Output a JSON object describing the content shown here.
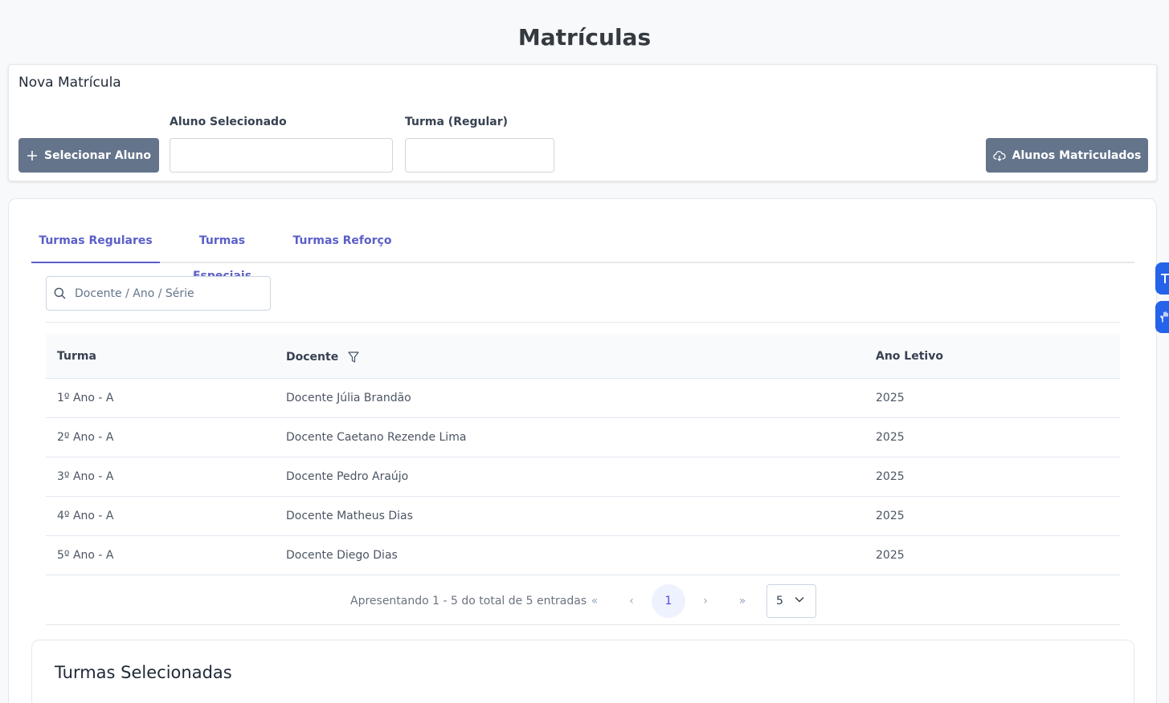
{
  "page": {
    "title": "Matrículas"
  },
  "new_enrollment": {
    "title": "Nova Matrícula",
    "select_student_button": "Selecionar Aluno",
    "student_label": "Aluno Selecionado",
    "student_value": "",
    "class_label": "Turma (Regular)",
    "class_value": "",
    "enrolled_button": "Alunos Matriculados"
  },
  "tabs": [
    {
      "label": "Turmas Regulares",
      "active": true
    },
    {
      "label": "Turmas Especiais",
      "active": false
    },
    {
      "label": "Turmas Reforço",
      "active": false
    }
  ],
  "search": {
    "placeholder": "Docente / Ano / Série"
  },
  "table": {
    "headers": {
      "turma": "Turma",
      "docente": "Docente",
      "ano_letivo": "Ano Letivo"
    },
    "rows": [
      {
        "turma": "1º Ano - A",
        "docente": "Docente Júlia Brandão",
        "ano_letivo": "2025"
      },
      {
        "turma": "2º Ano - A",
        "docente": "Docente Caetano Rezende Lima",
        "ano_letivo": "2025"
      },
      {
        "turma": "3º Ano - A",
        "docente": "Docente Pedro Araújo",
        "ano_letivo": "2025"
      },
      {
        "turma": "4º Ano - A",
        "docente": "Docente Matheus Dias",
        "ano_letivo": "2025"
      },
      {
        "turma": "5º Ano - A",
        "docente": "Docente Diego Dias",
        "ano_letivo": "2025"
      }
    ]
  },
  "pagination": {
    "info": "Apresentando 1 - 5 do total de 5 entradas",
    "current_page": "1",
    "rows_per_page": "5",
    "first": "«",
    "prev": "‹",
    "next": "›",
    "last": "»"
  },
  "selected_classes": {
    "title": "Turmas Selecionadas"
  },
  "colors": {
    "accent": "#5b5fc7",
    "button": "#64748b",
    "widget": "#2563eb"
  }
}
